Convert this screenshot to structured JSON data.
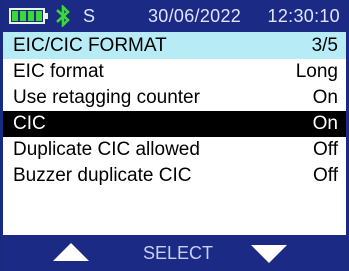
{
  "status_bar": {
    "battery_icon": "battery-full-icon",
    "bluetooth_icon": "bluetooth-icon",
    "signal_label": "S",
    "date": "30/06/2022",
    "time": "12:30:10",
    "colors": {
      "bar_background": "#1b2a85",
      "battery_fill": "#38d938"
    }
  },
  "menu": {
    "header": {
      "title": "EIC/CIC FORMAT",
      "page": "3/5",
      "background": "#b7ecf7"
    },
    "items": [
      {
        "label": "EIC format",
        "value": "Long",
        "selected": false
      },
      {
        "label": "Use retagging counter",
        "value": "On",
        "selected": false
      },
      {
        "label": "CIC",
        "value": "On",
        "selected": true
      },
      {
        "label": "Duplicate CIC allowed",
        "value": "Off",
        "selected": false
      },
      {
        "label": "Buzzer duplicate CIC",
        "value": "Off",
        "selected": false
      }
    ],
    "selected_background": "#000000"
  },
  "soft_keys": {
    "up_icon": "triangle-up-icon",
    "select_label": "SELECT",
    "down_icon": "triangle-down-icon",
    "background": "#1b2a85"
  }
}
